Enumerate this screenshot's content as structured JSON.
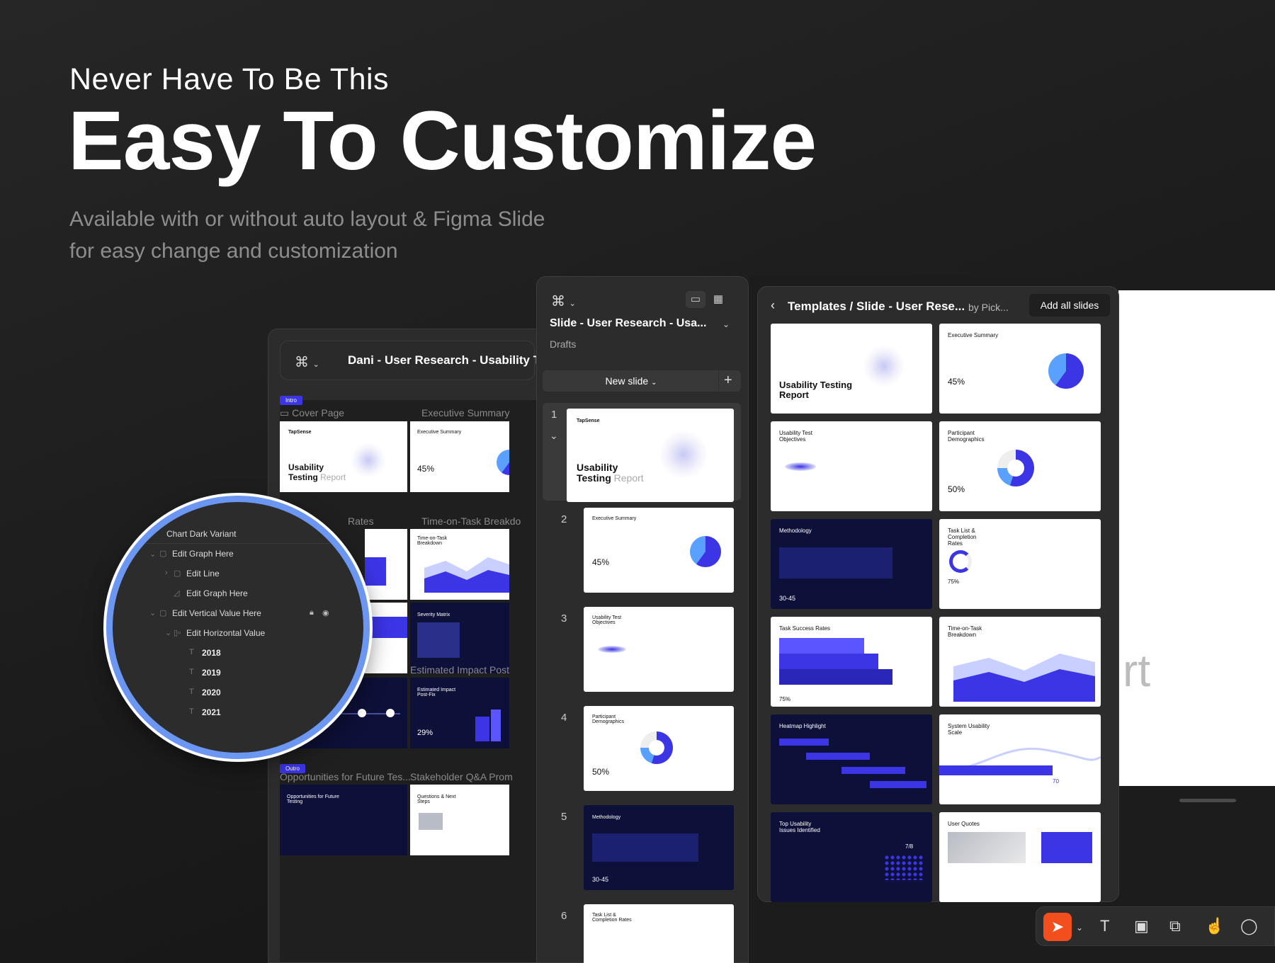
{
  "hero": {
    "subtitle": "Never Have To Be This",
    "title": "Easy To Customize",
    "description_line1": "Available with or without auto layout  & Figma Slide",
    "description_line2": "for easy change and customization"
  },
  "left_window": {
    "file_title": "Dani - User Research - Usability Tes",
    "sections": {
      "intro_tag": "Intro",
      "cover_page": "Cover Page",
      "executive_summary": "Executive Summary",
      "rates": "Rates",
      "time_on_task": "Time-on-Task Breakdo",
      "estimated_impact": "Estimated Impact Post",
      "outro_tag": "Outro",
      "opportunities": "Opportunities for Future Tes...",
      "stakeholder": "Stakeholder Q&A Prom"
    },
    "thumb_texts": {
      "usability": "Usability",
      "testing": "Testing",
      "report": "Report",
      "exec_summary": "Executive Summary",
      "pct45": "45%",
      "time_on_task": "Time-on-Task Breakdown",
      "severity": "Severity Matrix",
      "estimated": "Estimated Impact Post-Fix",
      "pct29": "29%",
      "opportunities": "Opportunities for Future Testing",
      "questions": "Questions & Next Steps"
    }
  },
  "magnifier": {
    "layers": [
      {
        "label": "Chart Dark Variant"
      },
      {
        "label": "Edit Graph Here"
      },
      {
        "label": "Edit Line"
      },
      {
        "label": "Edit Graph Here"
      },
      {
        "label": "Edit Vertical Value Here"
      },
      {
        "label": "Edit Horizontal Value"
      },
      {
        "label": "2018"
      },
      {
        "label": "2019"
      },
      {
        "label": "2020"
      },
      {
        "label": "2021"
      }
    ]
  },
  "slides_panel": {
    "file_title": "Slide - User Research - Usa...",
    "location": "Drafts",
    "new_slide_label": "New slide",
    "slides": [
      {
        "num": "1",
        "title": "Usability",
        "title2": "Testing",
        "soft": "Report"
      },
      {
        "num": "2",
        "title": "Executive Summary",
        "stat": "45%"
      },
      {
        "num": "3",
        "title": "Usability Test Objectives"
      },
      {
        "num": "4",
        "title": "Participant Demographics",
        "stat": "50%"
      },
      {
        "num": "5",
        "title": "Methodology",
        "stat": "30-45"
      },
      {
        "num": "6",
        "title": "Task List & Completion Rates"
      }
    ]
  },
  "templates_panel": {
    "breadcrumb": "Templates / Slide - User Rese...",
    "author": "by Pick...",
    "add_all_label": "Add all slides",
    "cards": [
      {
        "title": "Usability Testing Report",
        "dark": false
      },
      {
        "title": "Executive Summary",
        "stat": "45%",
        "dark": false
      },
      {
        "title": "Usability Test Objectives",
        "dark": false
      },
      {
        "title": "Participant Demographics",
        "stat": "50%",
        "dark": false
      },
      {
        "title": "Methodology",
        "stat": "30-45",
        "dark": true
      },
      {
        "title": "Task List & Completion Rates",
        "stat": "75%",
        "dark": false
      },
      {
        "title": "Task Success Rates",
        "stat": "75%",
        "dark": false
      },
      {
        "title": "Time-on-Task Breakdown",
        "dark": false
      },
      {
        "title": "Heatmap Highlight",
        "dark": true
      },
      {
        "title": "System Usability Scale",
        "stat": "70",
        "dark": false
      },
      {
        "title": "Top Usability Issues Identified",
        "stat": "7/8",
        "dark": true
      },
      {
        "title": "User Quotes",
        "dark": false
      }
    ],
    "canvas_fragment": "rt"
  },
  "toolbar": {
    "tools": [
      "move-tool",
      "text-tool",
      "image-tool",
      "shape-tool",
      "interaction-tool",
      "comment-tool"
    ]
  },
  "colors": {
    "accent_blue": "#3b35e6",
    "figma_orange": "#f24e1e",
    "magnifier_ring": "#6b97f3",
    "dark_slide": "#0d1038"
  }
}
